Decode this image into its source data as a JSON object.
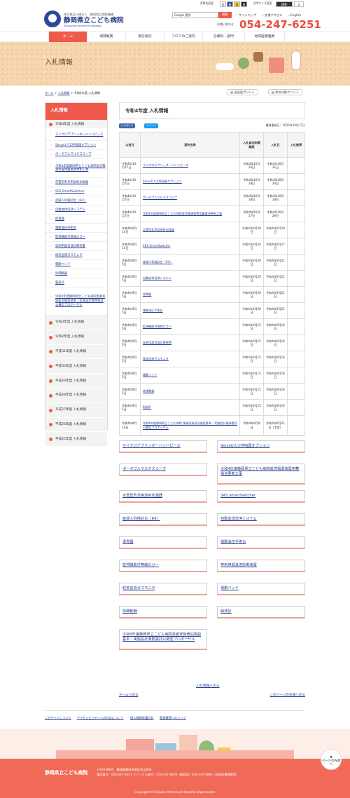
{
  "header": {
    "org_sub": "地方独立行政法人　静岡県立病院機構",
    "name": "静岡県立こども病院",
    "name_en": "Shizuoka Children's Hospital",
    "util_bg_label": "背景色変更",
    "util_bg_opts": [
      "白",
      "青",
      "黄",
      "黒"
    ],
    "util_size_label": "文字サイズ変更",
    "util_size_opts": [
      "標準",
      "大"
    ],
    "search_placeholder": "Google 提供",
    "search_btn": "検索",
    "top_links": [
      "サイトマップ",
      "交通アクセス",
      "English"
    ],
    "tel_label": "お問い合わせ",
    "tel": "054-247-6251"
  },
  "nav": [
    "ホーム",
    "病院概要",
    "受診案内",
    "フロアのご案内",
    "診療科・部門",
    "地域医療連携"
  ],
  "banner": {
    "title": "入札情報"
  },
  "breadcrumb": {
    "items": [
      "ホーム",
      "入札情報",
      "令和4年度 入札情報"
    ],
    "sep": ">"
  },
  "print": {
    "all": "全画面プリント",
    "body": "本文印刷プリント"
  },
  "sidebar": {
    "title": "入札情報",
    "current": "令和4年度 入札情報",
    "subitems": [
      "マイクロデブリッダーハンドピース",
      "SeryoU人工呼吸器オプション",
      "ポータブルマルチスコープ",
      "令和4年度静岡県立こども病院産涜電源装置用蓄電池更新工事",
      "定置型乳児用放射加温器",
      "SRS SmartSwitcher",
      "産婦人科検診台（R4）",
      "自動血球洗浄システム",
      "保育器",
      "電動油圧手術台",
      "監視機能付無線ロガー",
      "穿刺用超音波診断装置",
      "経皮血液ガスモニタ",
      "電動ベッド",
      "除細動器",
      "脳波計",
      "令和4年度静岡県立こども病院患者家族宿泊施設基本・実施設計業務委託公募型プロポーザル"
    ],
    "years": [
      "令和3年度 入札情報",
      "令和2年度 入札情報",
      "平成31年度 入札情報",
      "平成30年度 入札情報",
      "平成29年度 入札情報",
      "平成28年度 入札情報",
      "平成27年度 入札情報",
      "平成26年度 入札情報",
      "平成25年度 入札情報"
    ]
  },
  "main": {
    "title": "令和4年度 入札情報",
    "share": {
      "like": "いいね！0",
      "tweet": "ツイート"
    },
    "updated": "最終更新日：2022年10月17日",
    "table": {
      "headers": [
        "公告日",
        "案件名称",
        "入札参加申請期限",
        "入札日",
        "入札結果"
      ],
      "rows": [
        {
          "date": "令和4年10月17日",
          "name": "マイクロデブリッダーハンドピース",
          "deadline": "令和4年10月26日",
          "bid": "令和4年10月31日",
          "result": ""
        },
        {
          "date": "令和4年10月7日",
          "name": "SeryoU人工呼吸器オプション",
          "deadline": "令和4年10月18日",
          "bid": "令和4年10月20日",
          "result": ""
        },
        {
          "date": "令和4年10月7日",
          "name": "ポータブルマルチスコープ",
          "deadline": "令和4年10月18日",
          "bid": "令和4年10月19日",
          "result": ""
        },
        {
          "date": "令和4年10月7日",
          "name": "令和4年度静岡県立こども病院産涜電源装置用蓄電池更新工事",
          "deadline": "令和4年10月17日",
          "bid": "令和4年10月26日",
          "result": ""
        },
        {
          "date": "令和4年9月14日",
          "name": "定置型乳児用放射加温器",
          "deadline": "令和4年9月28日",
          "bid": "令和4年9月29日",
          "result": ""
        },
        {
          "date": "令和4年9月14日",
          "name": "SRS SmartSwitcher",
          "deadline": "令和4年9月26日",
          "bid": "令和4年9月27日",
          "result": ""
        },
        {
          "date": "令和4年9月5日",
          "name": "産婦人科検診台（R4）",
          "deadline": "令和4年9月20日",
          "bid": "令和4年9月21日",
          "result": ""
        },
        {
          "date": "令和4年9月5日",
          "name": "自動血球洗浄システム",
          "deadline": "令和4年9月20日",
          "bid": "令和4年9月21日",
          "result": ""
        },
        {
          "date": "令和4年9月5日",
          "name": "保育器",
          "deadline": "令和4年9月20日",
          "bid": "令和4年9月21日",
          "result": ""
        },
        {
          "date": "令和4年9月5日",
          "name": "電動油圧手術台",
          "deadline": "令和4年9月20日",
          "bid": "令和4年9月21日",
          "result": ""
        },
        {
          "date": "令和4年9月5日",
          "name": "監視機能付無線ロガー",
          "deadline": "令和4年9月15日",
          "bid": "令和4年9月16日",
          "result": ""
        },
        {
          "date": "令和4年9月5日",
          "name": "穿刺用超音波診断装置",
          "deadline": "令和4年9月15日",
          "bid": "令和4年9月16日",
          "result": ""
        },
        {
          "date": "令和4年9月5日",
          "name": "経皮血液ガスモニタ",
          "deadline": "令和4年9月15日",
          "bid": "令和4年9月16日",
          "result": ""
        },
        {
          "date": "令和4年9月5日",
          "name": "電動ベッド",
          "deadline": "令和4年9月15日",
          "bid": "令和4年9月16日",
          "result": ""
        },
        {
          "date": "令和4年9月5日",
          "name": "除細動器",
          "deadline": "令和4年9月15日",
          "bid": "令和4年9月16日",
          "result": ""
        },
        {
          "date": "令和4年9月5日",
          "name": "脳波計",
          "deadline": "令和4年9月15日",
          "bid": "令和4年9月16日",
          "result": ""
        },
        {
          "date": "令和4年8月16日",
          "name": "令和4年度静岡県立こども病院 患者家族宿泊施設基本・実施設計業務委託公募型プロポーザル",
          "deadline": "令和4年9月8日",
          "bid": "令和4年9月21日（予定）",
          "result": ""
        }
      ]
    },
    "cards": [
      "マイクロデブリッダーハンドピース",
      "SeryoU人工呼吸器オプション",
      "ポータブルマルチスコープ",
      "令和4年度静岡県立こども病院産涜電源装置用蓄電池更新工事",
      "定置型乳児用放射加温器",
      "SRS SmartSwitcher",
      "産婦人科検診台（R4）",
      "自動血球洗浄システム",
      "保育器",
      "電動油圧手術台",
      "監視機能付無線ロガー",
      "穿刺用超音波診断装置",
      "経皮血液ガスモニタ",
      "電動ベッド",
      "除細動器",
      "脳波計",
      "令和4年度静岡県立こども病院患者家族宿泊施設基本・実施設計業務委託公募型プロポーザル"
    ],
    "back_link": "入札情報へ戻る",
    "home_link": "ホームへ戻る",
    "top_link": "このページの先頭へ戻る"
  },
  "footer": {
    "links": [
      "このサイトについて",
      "アクセシビリティへの対応について",
      "個人情報保護方針",
      "関連機関へのリンク"
    ],
    "name": "静岡県立こども病院",
    "addr1": "〒420-8660　静岡県静岡市葵区漆山860",
    "addr2": "電話番号：054-247-6251 ファックス番号：054-247-6259（事務部）054-247-5869（地域医療連携室）",
    "copyright": "Copyright© Shizuoka Prefectural Hospital Organization",
    "totop": "ページの先頭へ"
  },
  "colors": {
    "accent": "#ef5a4c",
    "link": "#2a3f8f",
    "banner": "#f6d6ae"
  }
}
